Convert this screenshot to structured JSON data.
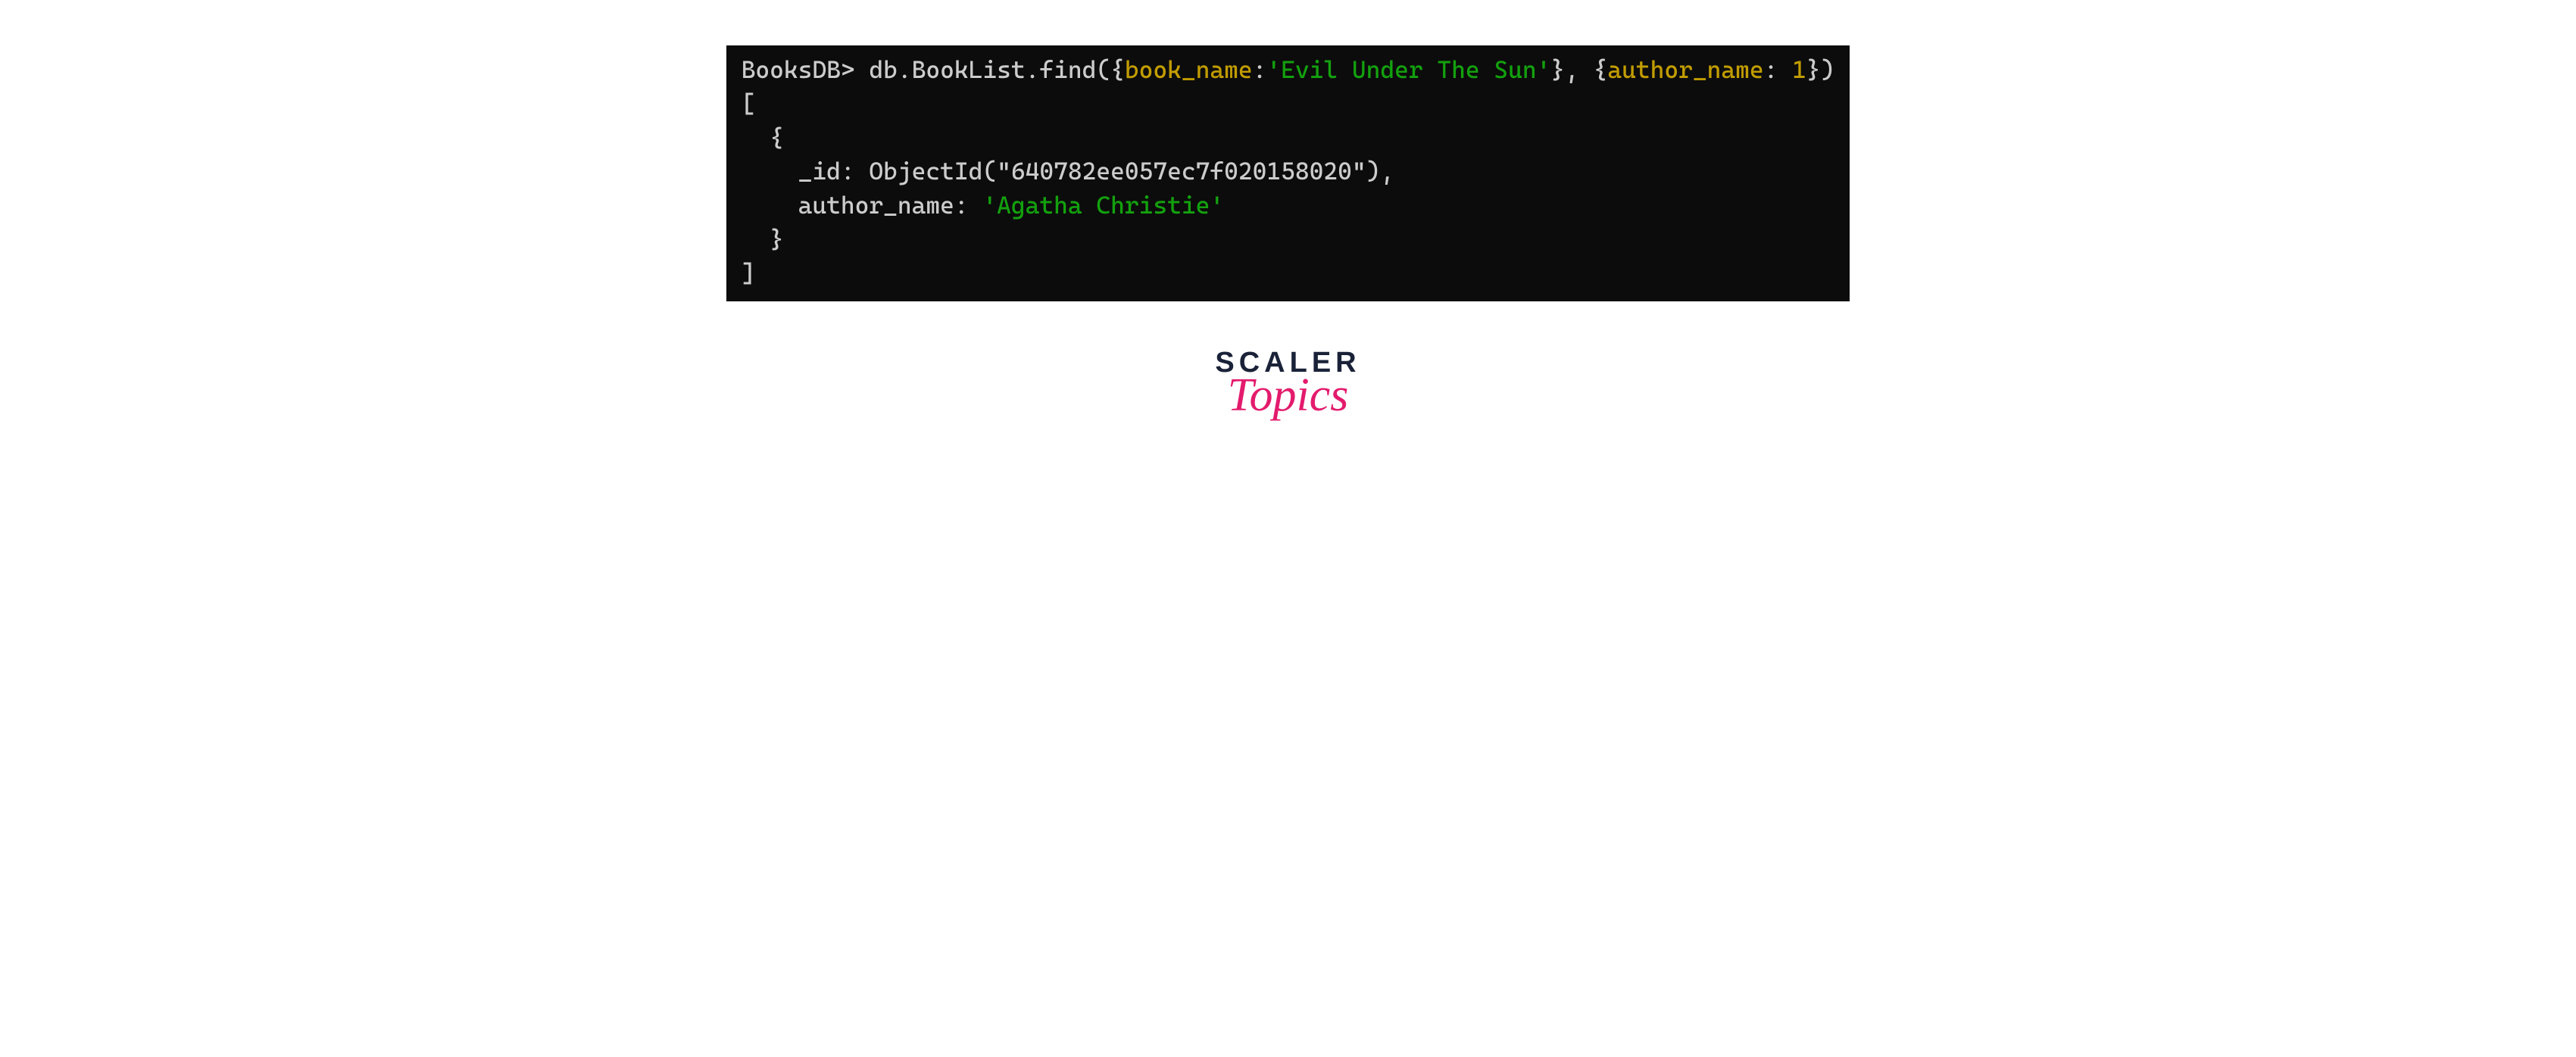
{
  "terminal": {
    "line1": {
      "prompt": "BooksDB>",
      "cmd_part1": " db.BookList.find({",
      "field1": "book_name",
      "colon1": ":",
      "string1": "'Evil Under The Sun'",
      "cmd_part2": "}, {",
      "field2": "author_name",
      "colon2": ": ",
      "num1": "1",
      "cmd_part3": "})"
    },
    "line2": "[",
    "line3": "  {",
    "line4": {
      "indent": "    ",
      "key1": "_id: ObjectId(",
      "oid": "\"640782ee057ec7f020158020\"",
      "close1": "),"
    },
    "line5": {
      "indent": "    ",
      "key2": "author_name: ",
      "val2": "'Agatha Christie'"
    },
    "line6": "  }",
    "line7": "]"
  },
  "logo": {
    "scaler": "SCALER",
    "topics": "Topics"
  }
}
